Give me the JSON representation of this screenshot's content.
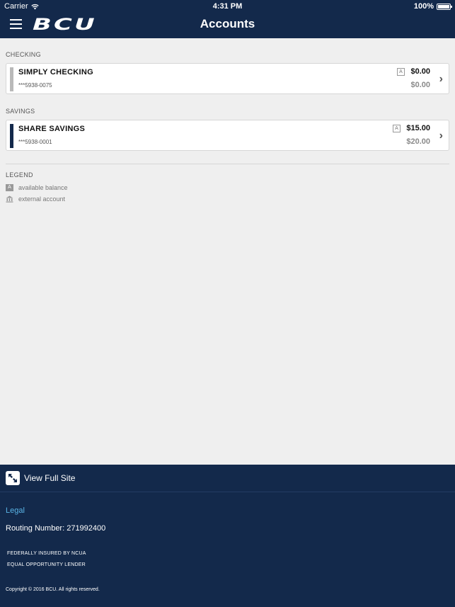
{
  "status_bar": {
    "carrier": "Carrier",
    "time": "4:31 PM",
    "battery": "100%"
  },
  "header": {
    "logo": "BCU",
    "title": "Accounts"
  },
  "sections": [
    {
      "label": "CHECKING",
      "account": {
        "name": "SIMPLY CHECKING",
        "number": "***5938-0075",
        "available": "$0.00",
        "current": "$0.00",
        "accent": "#b9b9b9"
      }
    },
    {
      "label": "SAVINGS",
      "account": {
        "name": "SHARE SAVINGS",
        "number": "***5938-0001",
        "available": "$15.00",
        "current": "$20.00",
        "accent": "#13294b"
      }
    }
  ],
  "legend": {
    "title": "LEGEND",
    "badge_letter": "A",
    "items": [
      "available balance",
      "external account"
    ]
  },
  "footer": {
    "view_full_site": "View Full Site",
    "legal": "Legal",
    "routing": "Routing Number: 271992400",
    "insured": "FEDERALLY INSURED BY NCUA",
    "lender": "EQUAL OPPORTUNITY LENDER",
    "copyright": "Copyright © 2016 BCU. All rights reserved."
  },
  "colors": {
    "navy": "#13294b",
    "link": "#5ab4e6",
    "background": "#efefef"
  }
}
